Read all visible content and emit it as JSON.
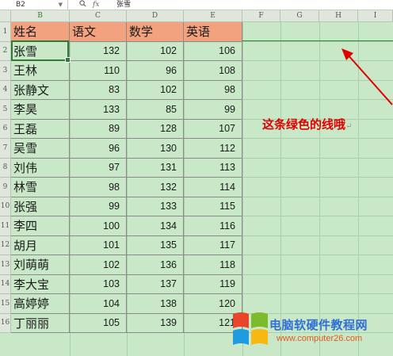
{
  "formula_bar": {
    "cell_ref": "B2",
    "zoom_icon": "magnifier-icon",
    "fx_label": "fx",
    "content": "张雪"
  },
  "columns": [
    "B",
    "C",
    "D",
    "E",
    "F",
    "G",
    "H",
    "I"
  ],
  "rows": [
    "1",
    "2",
    "3",
    "4",
    "5",
    "6",
    "7",
    "8",
    "9",
    "10",
    "11",
    "12",
    "13",
    "14",
    "15",
    "16"
  ],
  "selected_cell": {
    "column": "B",
    "row": "2"
  },
  "table": {
    "headers": [
      "姓名",
      "语文",
      "数学",
      "英语"
    ],
    "records": [
      {
        "name": "张雪",
        "chinese": "132",
        "math": "102",
        "english": "106"
      },
      {
        "name": "王林",
        "chinese": "110",
        "math": "96",
        "english": "108"
      },
      {
        "name": "张静文",
        "chinese": "83",
        "math": "102",
        "english": "98"
      },
      {
        "name": "李昊",
        "chinese": "133",
        "math": "85",
        "english": "99"
      },
      {
        "name": "王磊",
        "chinese": "89",
        "math": "128",
        "english": "107"
      },
      {
        "name": "吴雪",
        "chinese": "96",
        "math": "130",
        "english": "112"
      },
      {
        "name": "刘伟",
        "chinese": "97",
        "math": "131",
        "english": "113"
      },
      {
        "name": "林雪",
        "chinese": "98",
        "math": "132",
        "english": "114"
      },
      {
        "name": "张强",
        "chinese": "99",
        "math": "133",
        "english": "115"
      },
      {
        "name": "李四",
        "chinese": "100",
        "math": "134",
        "english": "116"
      },
      {
        "name": "胡月",
        "chinese": "101",
        "math": "135",
        "english": "117"
      },
      {
        "name": "刘萌萌",
        "chinese": "102",
        "math": "136",
        "english": "118"
      },
      {
        "name": "李大宝",
        "chinese": "103",
        "math": "137",
        "english": "119"
      },
      {
        "name": "高婷婷",
        "chinese": "104",
        "math": "138",
        "english": "120"
      },
      {
        "name": "丁丽丽",
        "chinese": "105",
        "math": "139",
        "english": "121"
      }
    ]
  },
  "annotation": {
    "text": "这条绿色的线哦",
    "color": "#e00000"
  },
  "watermark": {
    "title": "电脑软硬件教程网",
    "url": "www.computer26.com"
  },
  "colors": {
    "sheet_background": "#c9e8c8",
    "header_fill": "#f2a27e",
    "green_line": "#1f8f2a",
    "selection": "#2e7d32"
  }
}
